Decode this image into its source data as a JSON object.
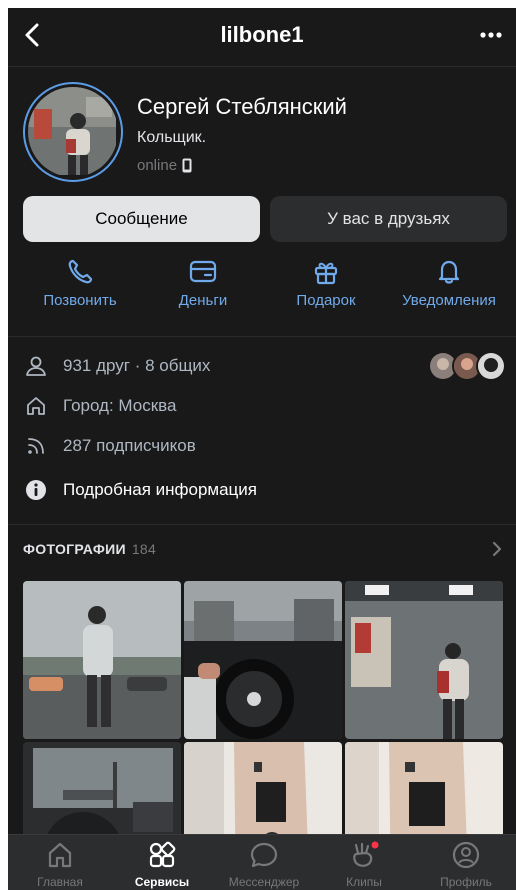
{
  "header": {
    "title": "lilbone1"
  },
  "profile": {
    "name": "Сергей Стеблянский",
    "status": "Кольщик.",
    "online": "online"
  },
  "buttons": {
    "message": "Сообщение",
    "friends": "У вас в друзьях"
  },
  "actions": [
    {
      "label": "Позвонить",
      "icon": "phone-icon"
    },
    {
      "label": "Деньги",
      "icon": "card-icon"
    },
    {
      "label": "Подарок",
      "icon": "gift-icon"
    },
    {
      "label": "Уведомления",
      "icon": "bell-icon"
    }
  ],
  "info": {
    "friends": "931 друг · 8 общих",
    "city": "Город: Москва",
    "followers": "287 подписчиков",
    "details": "Подробная информация"
  },
  "photos": {
    "title": "ФОТОГРАФИИ",
    "count": "184"
  },
  "tabs": [
    {
      "label": "Главная",
      "icon": "home-icon"
    },
    {
      "label": "Сервисы",
      "icon": "services-icon"
    },
    {
      "label": "Мессенджер",
      "icon": "chat-bubble-icon"
    },
    {
      "label": "Клипы",
      "icon": "clips-icon"
    },
    {
      "label": "Профиль",
      "icon": "profile-icon"
    }
  ],
  "colors": {
    "background": "#19191a",
    "accent": "#71aaeb",
    "notification_dot": "#ff3347"
  }
}
